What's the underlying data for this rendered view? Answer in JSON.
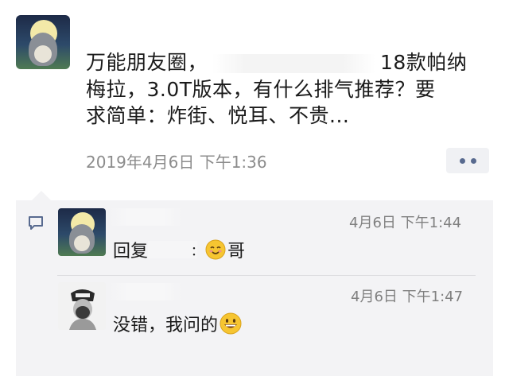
{
  "post": {
    "line1_before": "万能朋友圈，",
    "line1_after": "18款帕纳",
    "line2": "梅拉，3.0T版本，有什么排气推荐？要",
    "line3": "求简单：炸街、悦耳、不贵...",
    "time": "2019年4月6日 下午1:36"
  },
  "comments": [
    {
      "time": "4月6日 下午1:44",
      "text_prefix": "回复",
      "text_sep": "：",
      "text_suffix": "哥"
    },
    {
      "time": "4月6日 下午1:47",
      "text": "没错，我问的"
    }
  ],
  "icons": {
    "more": "ellipsis-icon",
    "comment": "comment-bubble-icon",
    "emoji_smile": "smiling-face-emoji",
    "emoji_grin": "grinning-face-emoji"
  },
  "colors": {
    "link_blue": "#586a8f",
    "panel_bg": "#f3f3f5",
    "time_gray": "#8c8c8c"
  }
}
